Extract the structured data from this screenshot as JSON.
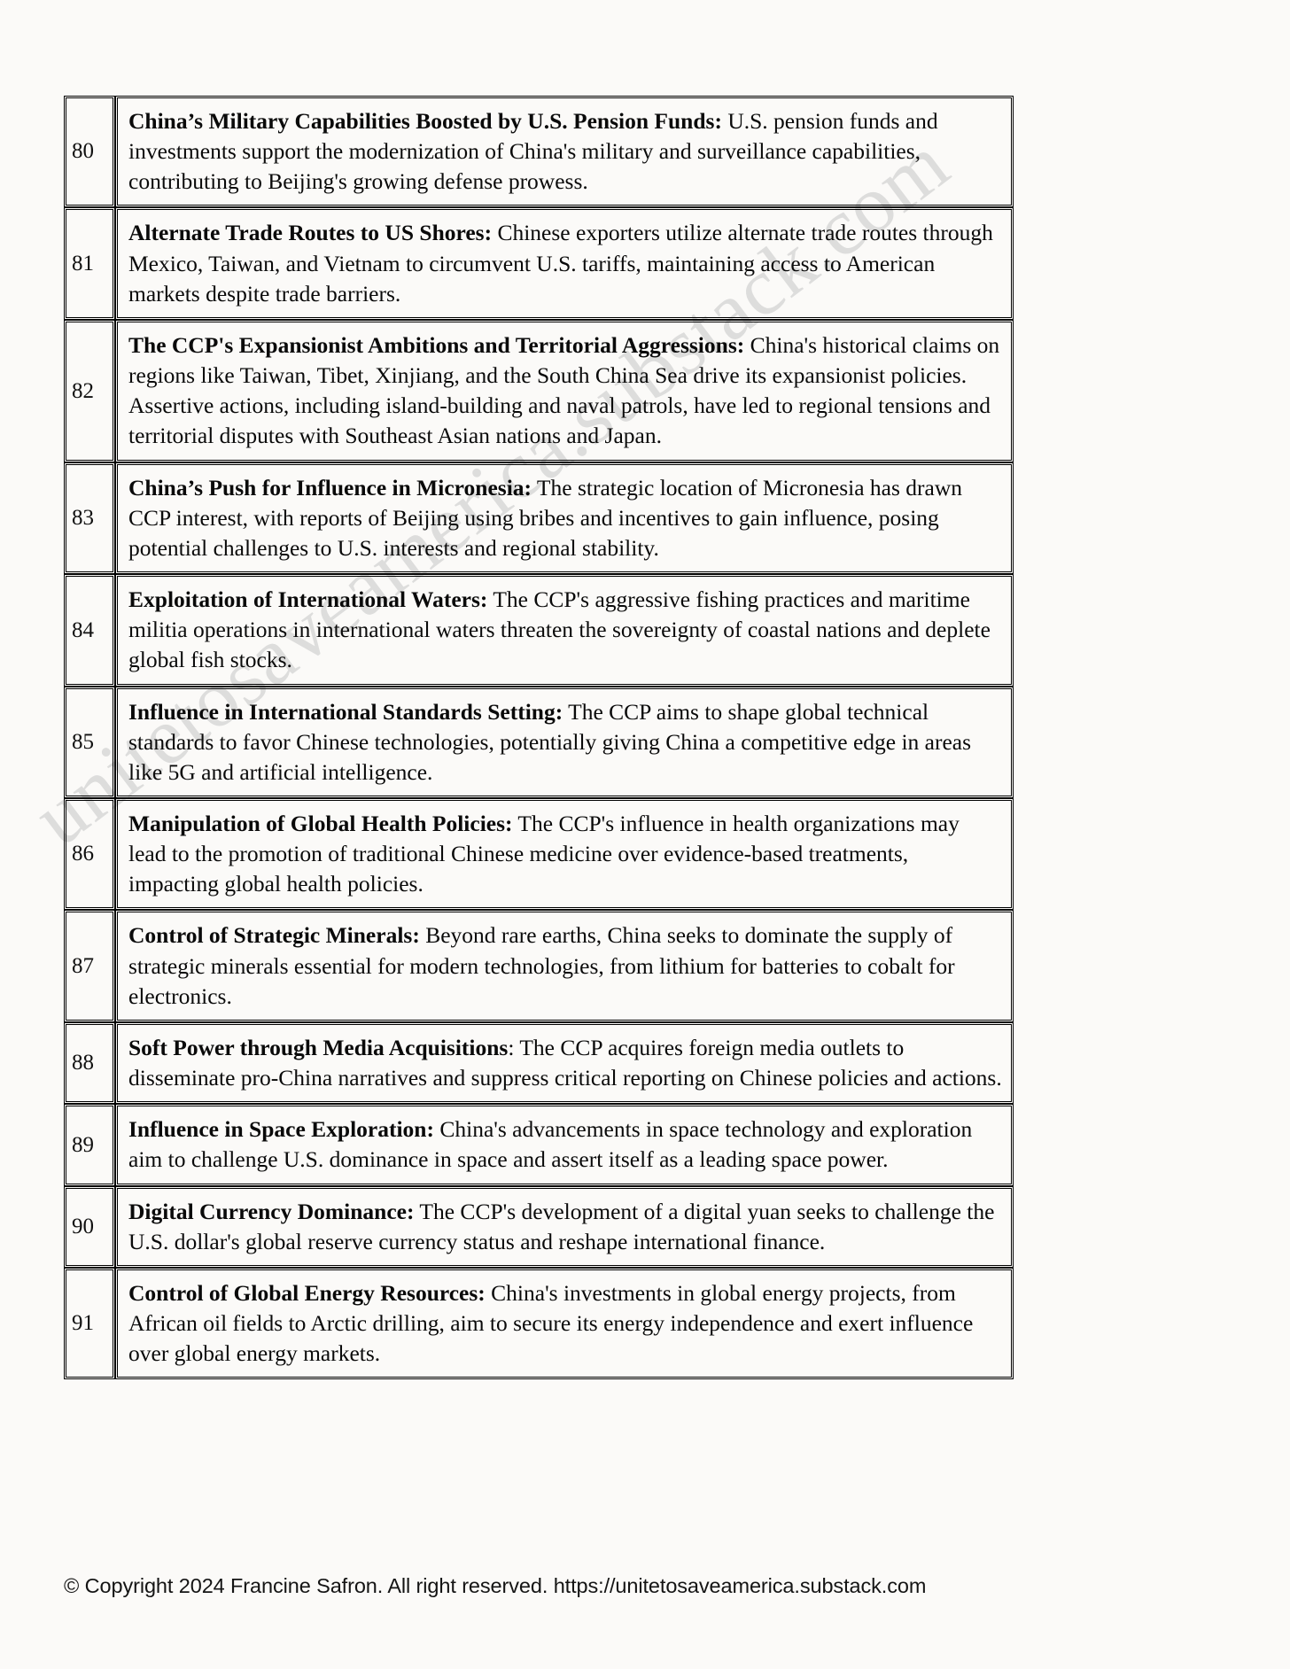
{
  "document": {
    "page_background": "#fbfaf8",
    "text_color": "#0a0a0a"
  },
  "watermark": {
    "text": "unitetosaveamerica.substack.com",
    "color": "#d8d8d8"
  },
  "table": {
    "columns": [
      "number",
      "entry"
    ],
    "rows": [
      {
        "number": "80",
        "title": "China’s Military Capabilities Boosted by U.S. Pension Funds:",
        "body": " U.S. pension funds and investments support the modernization of China's military and surveillance capabilities, contributing to Beijing's growing defense prowess."
      },
      {
        "number": "81",
        "title": "Alternate Trade Routes to US Shores:",
        "body": " Chinese exporters utilize alternate trade routes through Mexico, Taiwan, and Vietnam to circumvent U.S. tariffs, maintaining access to American markets despite trade barriers."
      },
      {
        "number": "82",
        "title": "The CCP's Expansionist Ambitions and Territorial Aggressions:",
        "body": " China's historical claims on regions like Taiwan, Tibet, Xinjiang, and the South China Sea drive its expansionist policies. Assertive actions, including island-building and naval patrols, have led to regional tensions and territorial disputes with Southeast Asian nations and Japan."
      },
      {
        "number": "83",
        "title": "China’s Push for Influence in Micronesia:",
        "body": " The strategic location of Micronesia has drawn CCP interest, with reports of Beijing using bribes and incentives to gain influence, posing potential challenges to U.S. interests and regional stability."
      },
      {
        "number": "84",
        "title": "Exploitation of International Waters:",
        "body": " The CCP's aggressive fishing practices and maritime militia operations in international waters threaten the sovereignty of coastal nations and deplete global fish stocks."
      },
      {
        "number": "85",
        "title": "Influence in International Standards Setting:",
        "body": " The CCP aims to shape global technical standards to favor Chinese technologies, potentially giving China a competitive edge in areas like 5G and artificial intelligence."
      },
      {
        "number": "86",
        "title": "Manipulation of Global Health Policies:",
        "body": " The CCP's influence in health organizations may lead to the promotion of traditional Chinese medicine over evidence-based treatments, impacting global health policies."
      },
      {
        "number": "87",
        "title": "Control of Strategic Minerals:",
        "body": " Beyond rare earths, China seeks to dominate the supply of strategic minerals essential for modern technologies, from lithium for batteries to cobalt for electronics."
      },
      {
        "number": "88",
        "title": "Soft Power through Media Acquisitions",
        "body": ": The CCP acquires foreign media outlets to disseminate pro-China narratives and suppress critical reporting on Chinese policies and actions."
      },
      {
        "number": "89",
        "title": "Influence in Space Exploration:",
        "body": " China's advancements in space technology and exploration aim to challenge U.S. dominance in space and assert itself as a leading space power."
      },
      {
        "number": "90",
        "title": "Digital Currency Dominance:",
        "body": " The CCP's development of a digital yuan seeks to challenge the U.S. dollar's global reserve currency status and reshape international finance."
      },
      {
        "number": "91",
        "title": "Control of Global Energy Resources:",
        "body": " China's investments in global energy projects, from African oil fields to Arctic drilling, aim to secure its energy independence and exert influence over global energy markets."
      }
    ]
  },
  "footer": {
    "copyright": "© Copyright 2024 Francine Safron. All right reserved. https://unitetosaveamerica.substack.com"
  }
}
